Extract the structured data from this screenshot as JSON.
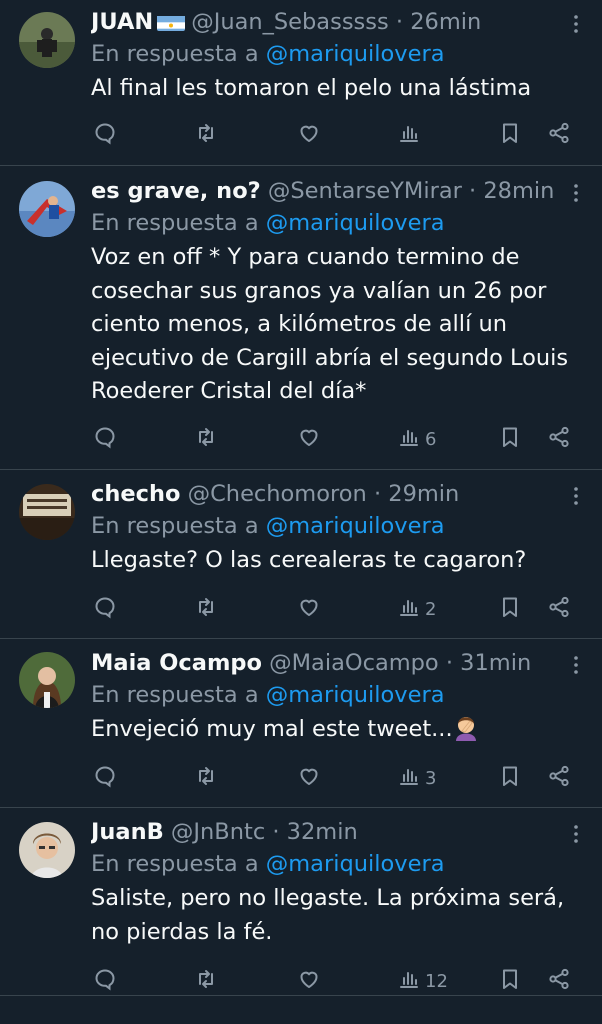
{
  "tweets": [
    {
      "name": "JUAN",
      "has_flag": true,
      "handle": "@Juan_Sebasssss",
      "time": "26min",
      "reply_prefix": "En respuesta a",
      "reply_to": "@mariquilovera",
      "text": "Al final les tomaron el pelo una lástima",
      "views": ""
    },
    {
      "name": "es grave, no?",
      "handle": "@SentarseYMirar",
      "time": "28min",
      "reply_prefix": "En respuesta a",
      "reply_to": "@mariquilovera",
      "text": "Voz en off * Y para cuando termino de cosechar sus granos ya valían un 26 por ciento menos, a kilómetros de allí un ejecutivo de Cargill abría el segundo Louis Roederer Cristal del día*",
      "views": "6"
    },
    {
      "name": "checho",
      "handle": "@Chechomoron",
      "time": "29min",
      "reply_prefix": "En respuesta a",
      "reply_to": "@mariquilovera",
      "text": "Llegaste? O las cerealeras te cagaron?",
      "views": "2"
    },
    {
      "name": "Maia Ocampo",
      "handle": "@MaiaOcampo",
      "time": "31min",
      "reply_prefix": "En respuesta a",
      "reply_to": "@mariquilovera",
      "text": "Envejeció muy mal este tweet...",
      "has_emoji": true,
      "views": "3"
    },
    {
      "name": "JuanB",
      "handle": "@JnBntc",
      "time": "32min",
      "reply_prefix": "En respuesta a",
      "reply_to": "@mariquilovera",
      "text": "Saliste, pero no llegaste. La próxima será, no pierdas la fé.",
      "views": "12"
    }
  ],
  "separator": "·",
  "icons": [
    "more-icon",
    "reply-icon",
    "retweet-icon",
    "like-icon",
    "views-icon",
    "bookmark-icon",
    "share-icon"
  ],
  "colors": {
    "background": "#15202b",
    "text": "#f7f9f9",
    "secondary": "#8b98a5",
    "accent": "#1d9bf0",
    "divider": "#38444d"
  }
}
